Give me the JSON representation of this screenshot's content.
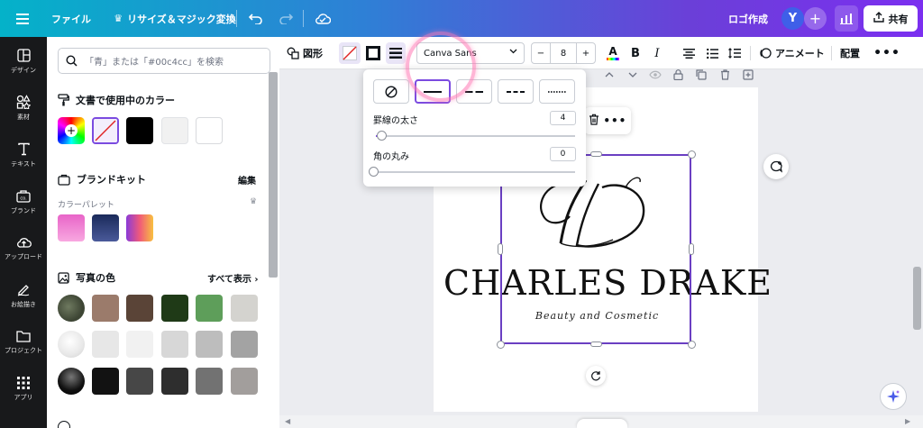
{
  "topbar": {
    "file_label": "ファイル",
    "resize_label": "リサイズ＆マジック変換",
    "logo_label": "ロゴ作成",
    "avatar_initial": "Y",
    "share_label": "共有"
  },
  "sidebar": {
    "items": [
      {
        "label": "デザイン",
        "icon": "layout-icon"
      },
      {
        "label": "素材",
        "icon": "elements-icon"
      },
      {
        "label": "テキスト",
        "icon": "text-icon"
      },
      {
        "label": "ブランド",
        "icon": "brand-icon"
      },
      {
        "label": "アップロード",
        "icon": "upload-icon"
      },
      {
        "label": "お絵描き",
        "icon": "draw-icon"
      },
      {
        "label": "プロジェクト",
        "icon": "folder-icon"
      },
      {
        "label": "アプリ",
        "icon": "apps-icon"
      }
    ]
  },
  "panel": {
    "search_placeholder": "「青」または「#00c4cc」を検索",
    "doc_colors_title": "文書で使用中のカラー",
    "brand_kit_title": "ブランドキット",
    "brand_edit": "編集",
    "palette_label": "カラーパレット",
    "photo_colors_title": "写真の色",
    "show_all": "すべて表示 ›",
    "doc_colors": [
      "#000000",
      "#f1f1f1",
      "#ffffff"
    ],
    "photo_colors_row1": [
      "#9b7b6b",
      "#5a4437",
      "#1f3a17",
      "#5e9e5a",
      "#d4d3cf"
    ],
    "photo_colors_row2": [
      "#e7e7e7",
      "#f1f1f1",
      "#d7d7d7",
      "#bdbdbd",
      "#a3a3a3"
    ],
    "photo_colors_row3": [
      "#121212",
      "#474747",
      "#2e2e2e",
      "#727272",
      "#a29e9c"
    ]
  },
  "toolbar": {
    "shape_label": "図形",
    "font_name": "Canva Sans",
    "font_size": "8",
    "animate_label": "アニメート",
    "position_label": "配置"
  },
  "border_popup": {
    "thickness_label": "罫線の太さ",
    "thickness_value": "4",
    "radius_label": "角の丸み",
    "radius_value": "0"
  },
  "canvas": {
    "brand_name": "CHARLES DRAKE",
    "tagline": "Beauty and Cosmetic",
    "monogram": "CD"
  },
  "colors": {
    "accent": "#6a3fc2",
    "sidebar_bg": "#18191b"
  }
}
